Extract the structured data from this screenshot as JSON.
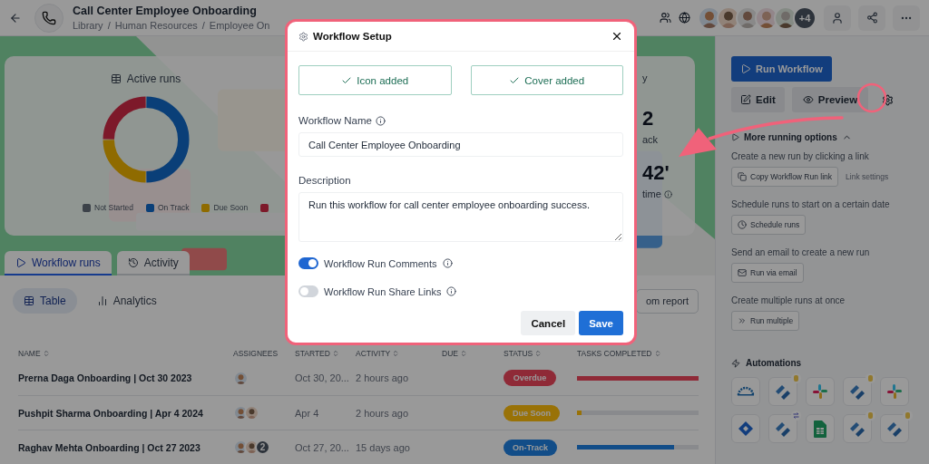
{
  "header": {
    "title": "Call Center Employee Onboarding",
    "breadcrumbs": {
      "separator": "/",
      "items": [
        "Library",
        "Human Resources",
        "Employee On"
      ]
    },
    "collaborators": [
      {
        "kind": "avatar"
      },
      {
        "kind": "avatar"
      },
      {
        "kind": "avatar"
      },
      {
        "kind": "avatar"
      },
      {
        "kind": "avatar"
      }
    ],
    "more_collaborators": "+4"
  },
  "stats": {
    "title": "Active runs",
    "legend": [
      {
        "label": "Not Started",
        "color": "#3c4249"
      },
      {
        "label": "On Track",
        "color": "#0a3f78"
      },
      {
        "label": "Due Soon",
        "color": "#8f6b00"
      },
      {
        "color": "#7d1a2a"
      }
    ],
    "fragments": [
      {
        "kind": "label",
        "text": "y"
      },
      {
        "kind": "value",
        "text": "2"
      },
      {
        "kind": "label",
        "text": "ack"
      },
      {
        "kind": "value",
        "text": "42'"
      },
      {
        "kind": "label-info",
        "text": "time"
      }
    ]
  },
  "tabs": [
    {
      "label": "Workflow runs",
      "selected": true
    },
    {
      "label": "Activity",
      "selected": false
    }
  ],
  "views": [
    {
      "label": "Table",
      "selected": true
    },
    {
      "label": "Analytics",
      "selected": false
    }
  ],
  "report_button": "om report",
  "table": {
    "columns": [
      {
        "label": "NAME",
        "sortable": true
      },
      {
        "label": "ASSIGNEES",
        "sortable": false
      },
      {
        "label": "STARTED",
        "sortable": true
      },
      {
        "label": "ACTIVITY",
        "sortable": true
      },
      {
        "label": "DUE",
        "sortable": true
      },
      {
        "label": "STATUS",
        "sortable": true
      },
      {
        "label": "TASKS COMPLETED",
        "sortable": true
      }
    ],
    "rows": [
      {
        "name": "Prerna Daga Onboarding | Oct 30 2023",
        "assignees": [
          {
            "kind": "avatar"
          }
        ],
        "started": "Oct 30, 20...",
        "activity": "2 hours ago",
        "status": {
          "label": "Overdue",
          "color": "#8f2a38"
        },
        "level": 1
      },
      {
        "name": "Pushpit Sharma Onboarding | Apr 4 2024",
        "assignees": [
          {
            "kind": "avatar"
          },
          {
            "kind": "avatar"
          }
        ],
        "started": "Apr 4",
        "activity": "2 hours ago",
        "status": {
          "label": "Due Soon",
          "color": "#997208"
        },
        "level": 0.04
      },
      {
        "name": "Raghav Mehta Onboarding | Oct 27 2023",
        "assignees": [
          {
            "kind": "avatar"
          },
          {
            "kind": "avatar"
          },
          {
            "kind": "count",
            "text": "2"
          }
        ],
        "started": "Oct 27, 20...",
        "activity": "15 days ago",
        "status": {
          "label": "On-Track",
          "color": "#124d88"
        },
        "level": 0.8
      }
    ]
  },
  "side": {
    "run_button": "Run Workflow",
    "edit_button": "Edit",
    "preview_button": "Preview",
    "more_options": {
      "title": "More running options",
      "expanded": true
    },
    "options": [
      {
        "text": "Create a new run by clicking a link",
        "button": "Copy Workflow Run link",
        "link": "Link settings"
      },
      {
        "text": "Schedule runs to start on a certain date",
        "button": "Schedule runs"
      },
      {
        "text": "Send an email to create a new run",
        "button": "Run via email"
      },
      {
        "text": "Create multiple runs at once",
        "button": "Run multiple"
      }
    ],
    "automations": {
      "title": "Automations",
      "tiles": [
        {
          "kind": "recruitee"
        },
        {
          "kind": "stripes",
          "badge": {
            "kind": "database"
          }
        },
        {
          "kind": "slack"
        },
        {
          "kind": "stripes",
          "badge": {
            "kind": "database"
          }
        },
        {
          "kind": "slack"
        },
        {
          "kind": "diamond"
        },
        {
          "kind": "stripes",
          "badge": {
            "kind": "sync"
          }
        },
        {
          "kind": "sheets"
        },
        {
          "kind": "stripes",
          "badge": {
            "kind": "database"
          }
        },
        {
          "kind": "stripes",
          "badge": {
            "kind": "database"
          }
        }
      ]
    }
  },
  "modal": {
    "title": "Workflow Setup",
    "assets": [
      {
        "label": "Icon added",
        "done": true
      },
      {
        "label": "Cover added",
        "done": true
      }
    ],
    "name_label": "Workflow Name",
    "name_value": "Call Center Employee Onboarding",
    "description_label": "Description",
    "description_value": "Run this workflow for call center employee onboarding success.",
    "toggles": [
      {
        "label": "Workflow Run Comments",
        "on": true
      },
      {
        "label": "Workflow Run Share Links",
        "on": false
      }
    ],
    "buttons": [
      {
        "label": "Cancel",
        "kind": "secondary"
      },
      {
        "label": "Save",
        "kind": "primary"
      }
    ]
  }
}
